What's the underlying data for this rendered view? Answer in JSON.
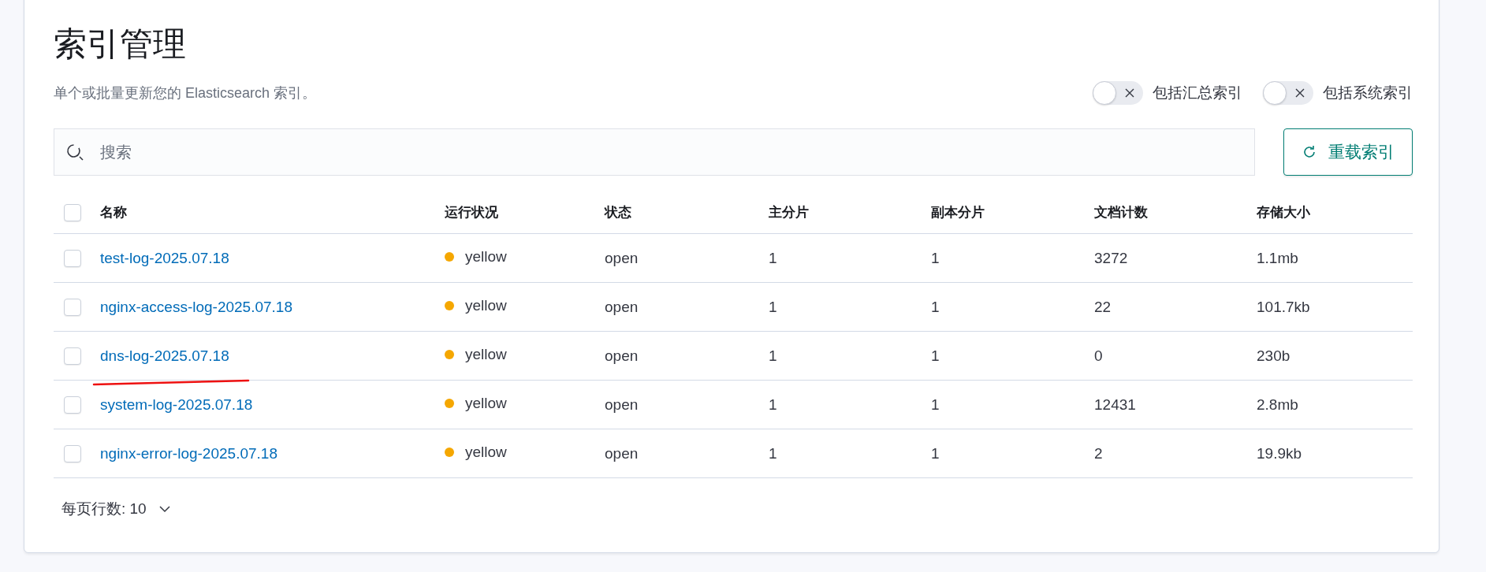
{
  "page": {
    "title": "索引管理",
    "description": "单个或批量更新您的 Elasticsearch 索引。"
  },
  "toggles": [
    {
      "label": "包括汇总索引",
      "on": false
    },
    {
      "label": "包括系统索引",
      "on": false
    }
  ],
  "search": {
    "placeholder": "搜索"
  },
  "reload_button": {
    "label": "重载索引"
  },
  "table": {
    "select_all": {
      "checked": false
    },
    "columns": [
      "名称",
      "运行状况",
      "状态",
      "主分片",
      "副本分片",
      "文档计数",
      "存储大小"
    ],
    "rows": [
      {
        "checked": false,
        "name": "test-log-2025.07.18",
        "health": "yellow",
        "color": "#f5a700",
        "status": "open",
        "primaries": "1",
        "replicas": "1",
        "docs_count": "3272",
        "storage_size": "1.1mb",
        "underlined": false
      },
      {
        "checked": false,
        "name": "nginx-access-log-2025.07.18",
        "health": "yellow",
        "color": "#f5a700",
        "status": "open",
        "primaries": "1",
        "replicas": "1",
        "docs_count": "22",
        "storage_size": "101.7kb",
        "underlined": false
      },
      {
        "checked": false,
        "name": "dns-log-2025.07.18",
        "health": "yellow",
        "color": "#f5a700",
        "status": "open",
        "primaries": "1",
        "replicas": "1",
        "docs_count": "0",
        "storage_size": "230b",
        "underlined": true
      },
      {
        "checked": false,
        "name": "system-log-2025.07.18",
        "health": "yellow",
        "color": "#f5a700",
        "status": "open",
        "primaries": "1",
        "replicas": "1",
        "docs_count": "12431",
        "storage_size": "2.8mb",
        "underlined": false
      },
      {
        "checked": false,
        "name": "nginx-error-log-2025.07.18",
        "health": "yellow",
        "color": "#f5a700",
        "status": "open",
        "primaries": "1",
        "replicas": "1",
        "docs_count": "2",
        "storage_size": "19.9kb",
        "underlined": false
      }
    ]
  },
  "pagination": {
    "rows_per_page": "每页行数: 10"
  }
}
